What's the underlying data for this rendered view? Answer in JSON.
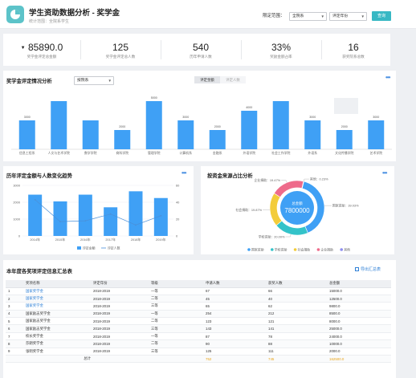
{
  "header": {
    "title": "学生资助数据分析 - 奖学金",
    "subtitle": "统计范围：全院系学生",
    "range_label": "限定范围：",
    "select1": "全院系",
    "select2": "评定年份",
    "query_button": "查询"
  },
  "stats": [
    {
      "value": "85890.0",
      "label": "奖学金评定总金额",
      "arrow": "▼"
    },
    {
      "value": "125",
      "label": "奖学金评定总人数"
    },
    {
      "value": "540",
      "label": "历年申请人数"
    },
    {
      "value": "33%",
      "label": "奖励金额占率"
    },
    {
      "value": "16",
      "label": "获奖院系总数"
    }
  ],
  "bar_section": {
    "title": "奖学金评定情况分析",
    "select": "按院系",
    "tab_active": "评定金额",
    "tab_inactive": "评定人数",
    "more": "•••"
  },
  "line_section": {
    "title": "历年评定金额与人数变化趋势",
    "more": "•••",
    "legend1": "评定金额",
    "legend2": "评定人数"
  },
  "pie_section": {
    "title": "按资金来源占比分析",
    "more": "•••",
    "center_label": "总金额",
    "center_value": "7800000",
    "legend": [
      "国家资助",
      "学校资助",
      "社会捐助",
      "企业捐助",
      "其他"
    ]
  },
  "table_section": {
    "title": "本年度各奖项评定信息汇总表",
    "export": "导出汇总表",
    "headers": [
      "",
      "奖项名称",
      "评定年份",
      "等级",
      "申请人数",
      "获奖人数",
      "总金额"
    ],
    "rows": [
      [
        "1",
        "国家奖学金",
        "2018-2019",
        "一等",
        "67",
        "66",
        "15000.0"
      ],
      [
        "2",
        "国家奖学金",
        "2018-2019",
        "二等",
        "45",
        "40",
        "12500.0"
      ],
      [
        "3",
        "国家奖学金",
        "2018-2019",
        "三等",
        "65",
        "62",
        "9800.0"
      ],
      [
        "4",
        "国家励志奖学金",
        "2018-2019",
        "一等",
        "254",
        "212",
        "8500.0"
      ],
      [
        "5",
        "国家励志奖学金",
        "2018-2019",
        "二等",
        "123",
        "121",
        "8000.0"
      ],
      [
        "6",
        "国家励志奖学金",
        "2018-2019",
        "三等",
        "143",
        "141",
        "25000.0"
      ],
      [
        "7",
        "校长奖学金",
        "2018-2019",
        "一等",
        "87",
        "78",
        "24000.0"
      ],
      [
        "8",
        "莎朗奖学金",
        "2018-2019",
        "二等",
        "90",
        "88",
        "10000.0"
      ],
      [
        "9",
        "张明奖学金",
        "2018-2019",
        "三等",
        "125",
        "111",
        "2000.0"
      ]
    ],
    "total": {
      "label": "总计",
      "apply": "752",
      "award": "745",
      "amount": "162500.0"
    }
  },
  "colors": {
    "accent": "#38b8c4",
    "bar": "#3fa0f5",
    "pie": [
      "#3fa0f5",
      "#34c3c9",
      "#f3cc3a",
      "#ee6b8b",
      "#8e8ef0"
    ]
  },
  "chart_data": [
    {
      "type": "bar",
      "title": "奖学金评定情况分析",
      "categories": [
        "信息工程系",
        "人文与艺术学院",
        "数学学院",
        "商科学院",
        "管理学院",
        "计算机系",
        "金融系",
        "外语学院",
        "社会工作学院",
        "外语系",
        "文化传播学院",
        "艺术学院"
      ],
      "values": [
        3000,
        5000,
        3000,
        2000,
        5000,
        3000,
        2000,
        4000,
        5000,
        3000,
        2000,
        3000
      ],
      "data_labels": [
        "3000",
        "",
        "",
        "2000",
        "5000",
        "3000",
        "2000",
        "4000",
        "",
        "3000",
        "2000",
        "3000"
      ],
      "ylim": [
        0,
        5500
      ]
    },
    {
      "type": "bar",
      "title": "历年评定金额与人数变化趋势",
      "categories": [
        "2014年",
        "2015年",
        "2016年",
        "2017年",
        "2018年",
        "2019年"
      ],
      "values": [
        2450,
        2050,
        2450,
        1700,
        2650,
        2250
      ],
      "line": [
        43,
        17,
        18,
        26,
        13,
        24
      ],
      "yticks": [
        "3000",
        "2000",
        "1000",
        "0"
      ],
      "y2ticks": [
        "60",
        "40",
        "20",
        "0"
      ]
    },
    {
      "type": "pie",
      "title": "按资金来源占比分析",
      "slices": [
        {
          "name": "国家资助",
          "value": 39.03,
          "label": "国家资助：39.03%"
        },
        {
          "name": "学校资助",
          "value": 20.0,
          "label": "学校资助：20.00%"
        },
        {
          "name": "社会捐助",
          "value": 19.87,
          "label": "社会捐助：19.87%"
        },
        {
          "name": "企业捐助",
          "value": 19.47,
          "label": "企业捐助：19.47%"
        },
        {
          "name": "其他",
          "value": 0.23,
          "label": "其他：0.23%"
        }
      ]
    }
  ]
}
